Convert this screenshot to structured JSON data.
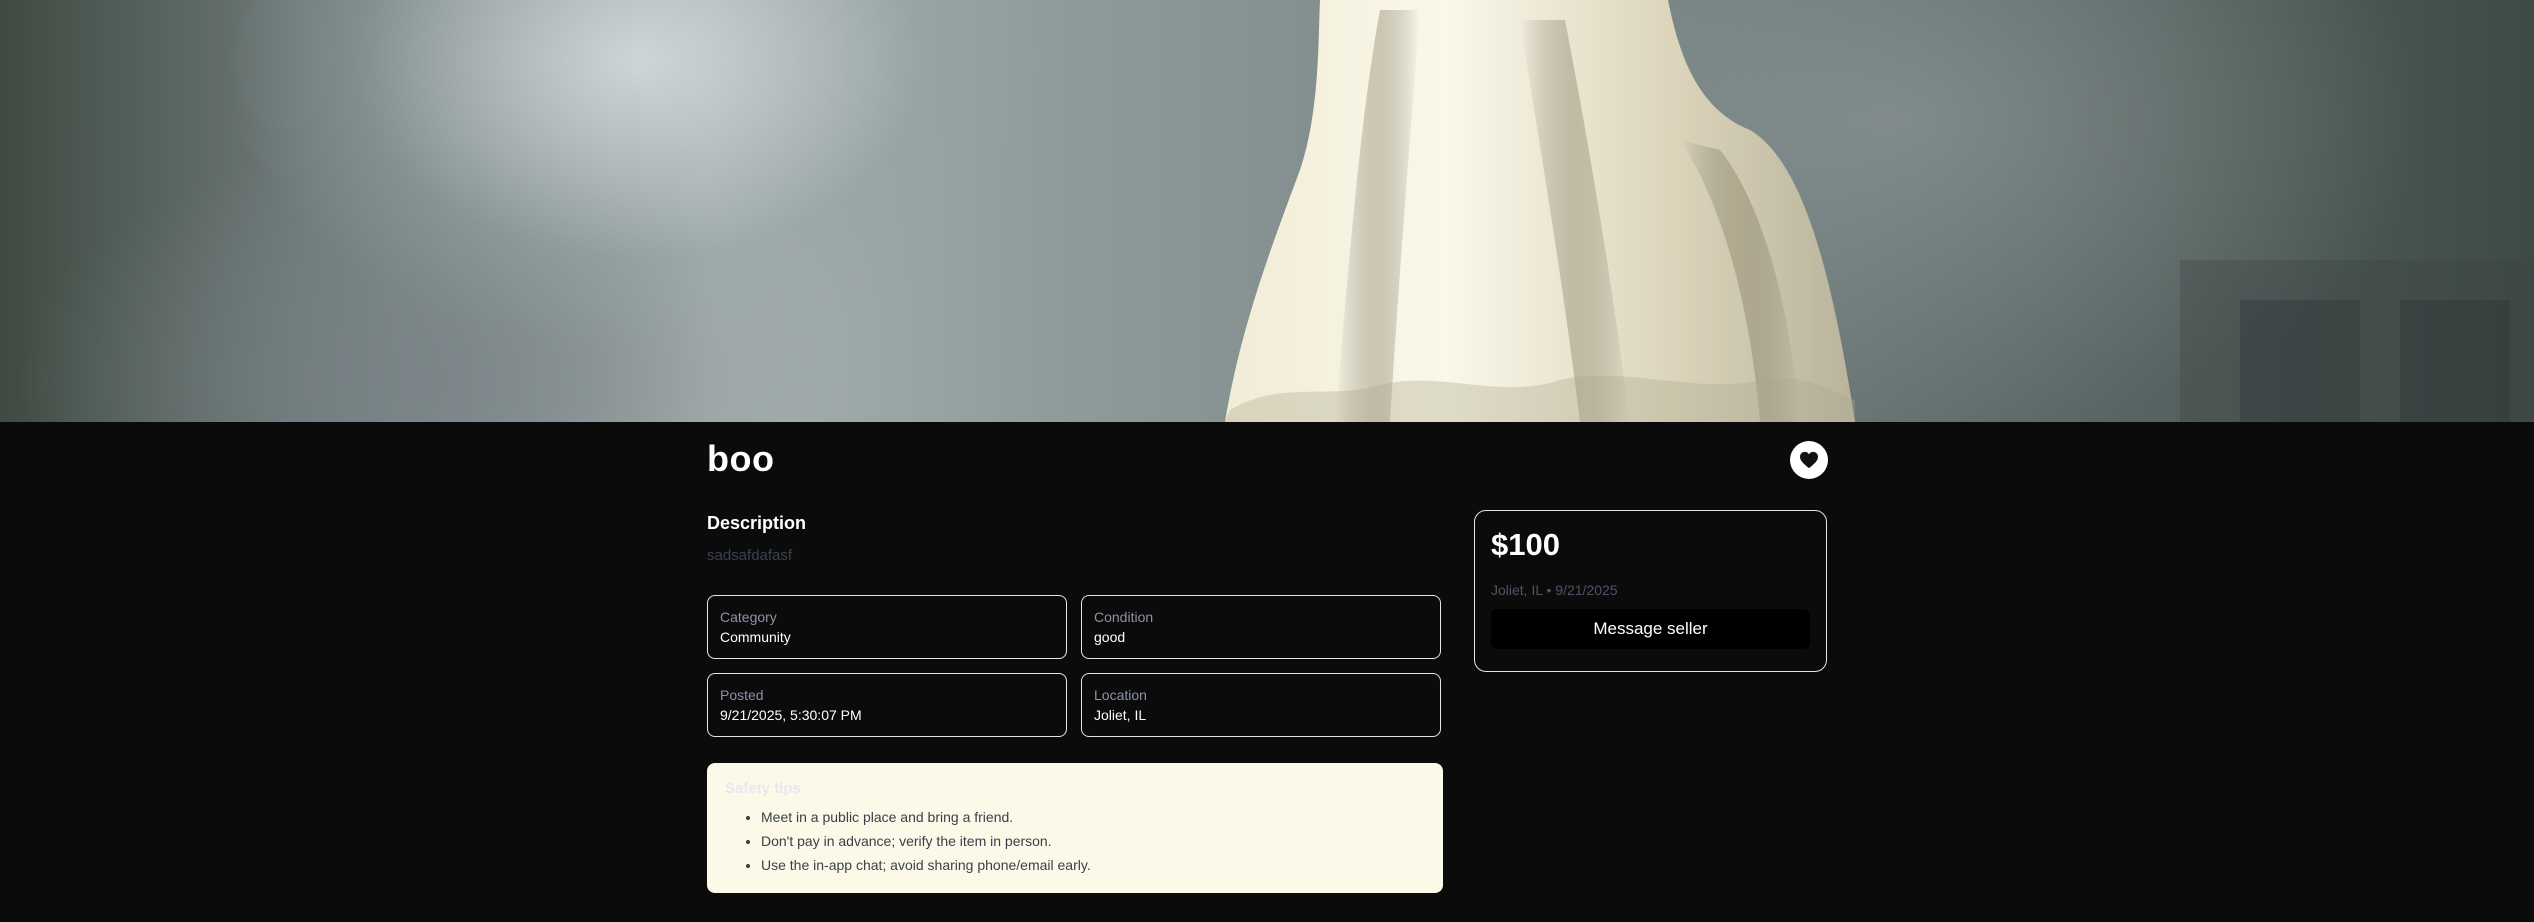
{
  "listing": {
    "title": "boo",
    "hero_image_alt": "ghost-photo",
    "favorite_icon": "heart-icon"
  },
  "description": {
    "heading": "Description",
    "text": "sadsafdafasf"
  },
  "details": {
    "category": {
      "label": "Category",
      "value": "Community"
    },
    "condition": {
      "label": "Condition",
      "value": "good"
    },
    "posted": {
      "label": "Posted",
      "value": "9/21/2025, 5:30:07 PM"
    },
    "location": {
      "label": "Location",
      "value": "Joliet, IL"
    }
  },
  "safety": {
    "title": "Safety tips",
    "tips": [
      "Meet in a public place and bring a friend.",
      "Don't pay in advance; verify the item in person.",
      "Use the in-app chat; avoid sharing phone/email early."
    ]
  },
  "sidebar": {
    "price": "$100",
    "meta": "Joliet, IL • 9/21/2025",
    "message_label": "Message seller"
  },
  "colors": {
    "page_bg": "#0b0b0b",
    "safety_bg": "#fcf9e8",
    "label_gray": "#8b93a6"
  }
}
